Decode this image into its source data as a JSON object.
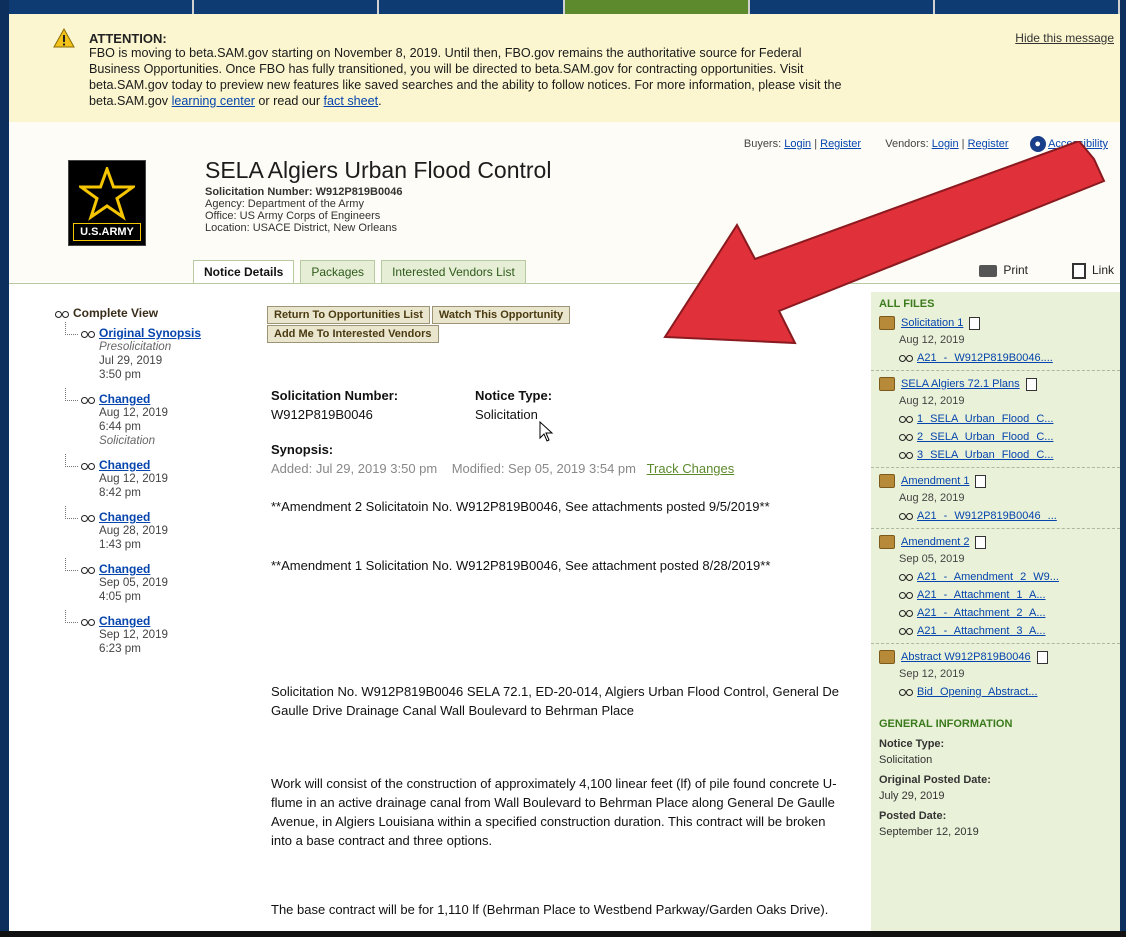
{
  "attention": {
    "title": "ATTENTION:",
    "hide": "Hide this message",
    "line1": "FBO is moving to beta.SAM.gov starting on November 8, 2019. Until then, FBO.gov remains the authoritative source for Federal",
    "line2": "Business Opportunities. Once FBO has fully transitioned, you will be directed to beta.SAM.gov for contracting opportunities. Visit",
    "line3": "beta.SAM.gov today to preview new features like saved searches and the ability to follow notices. For more information, please visit the",
    "line4_prefix": "beta.SAM.gov",
    "learning_center": "learning center",
    "line4_mid": "or read our",
    "fact_sheet": "fact sheet",
    "line4_suffix": "."
  },
  "login": {
    "buyers_label": "Buyers:",
    "buyers_login": "Login",
    "buyers_register": "Register",
    "vendors_label": "Vendors:",
    "vendors_login": "Login",
    "vendors_register": "Register",
    "accessibility": "Accessibility"
  },
  "logo": {
    "text": "U.S.ARMY"
  },
  "notice": {
    "title": "SELA Algiers Urban Flood Control",
    "solicitation_line": "Solicitation Number: W912P819B0046",
    "agency": "Agency: Department of the Army",
    "office": "Office: US Army Corps of Engineers",
    "location": "Location: USACE District, New Orleans"
  },
  "tabs": [
    {
      "label": "Notice Details"
    },
    {
      "label": "Packages"
    },
    {
      "label": "Interested Vendors List"
    }
  ],
  "tools": {
    "print": "Print",
    "link": "Link"
  },
  "history": {
    "title": "Complete View",
    "items": [
      {
        "label": "Original Synopsis",
        "type": "Presolicitation",
        "date": "Jul 29, 2019",
        "time": "3:50 pm"
      },
      {
        "label": "Changed",
        "date": "Aug 12, 2019",
        "time": "6:44 pm",
        "type": "Solicitation"
      },
      {
        "label": "Changed",
        "date": "Aug 12, 2019",
        "time": "8:42 pm"
      },
      {
        "label": "Changed",
        "date": "Aug 28, 2019",
        "time": "1:43 pm"
      },
      {
        "label": "Changed",
        "date": "Sep 05, 2019",
        "time": "4:05 pm"
      },
      {
        "label": "Changed",
        "date": "Sep 12, 2019",
        "time": "6:23 pm"
      }
    ]
  },
  "actions": {
    "return": "Return To Opportunities List",
    "watch": "Watch This Opportunity",
    "add_me": "Add Me To Interested Vendors"
  },
  "details": {
    "sol_number_label": "Solicitation Number:",
    "sol_number": "W912P819B0046",
    "notice_type_label": "Notice Type:",
    "notice_type": "Solicitation",
    "synopsis_label": "Synopsis:",
    "added": "Added: Jul 29, 2019 3:50 pm",
    "modified": "Modified: Sep 05, 2019 3:54 pm",
    "track_changes": "Track Changes",
    "amend2": "**Amendment 2 Solicitatoin No. W912P819B0046, See attachments posted 9/5/2019**",
    "amend1": "**Amendment 1 Solicitation No. W912P819B0046, See attachment posted 8/28/2019**",
    "body1": "Solicitation No. W912P819B0046 SELA 72.1, ED-20-014, Algiers Urban Flood Control, General De Gaulle Drive Drainage Canal Wall Boulevard to Behrman Place",
    "body2": "Work will consist of the construction of approximately 4,100 linear feet (lf) of pile found concrete U-flume in an active drainage canal from Wall Boulevard to Behrman Place along General De Gaulle Avenue, in Algiers Louisiana within a specified construction duration. This contract will be broken into a base contract and three options.",
    "body3": "The base contract will be for 1,110 lf (Behrman Place to Westbend Parkway/Garden Oaks Drive)."
  },
  "files": {
    "title": "ALL FILES",
    "groups": [
      {
        "name": "Solicitation 1",
        "date": "Aug 12, 2019",
        "items": [
          "A21 - W912P819B0046...."
        ]
      },
      {
        "name": "SELA Algiers 72.1 Plans",
        "date": "Aug 12, 2019",
        "items": [
          "1 SELA Urban Flood C...",
          "2 SELA Urban Flood C...",
          "3 SELA Urban Flood C..."
        ]
      },
      {
        "name": "Amendment 1",
        "date": "Aug 28, 2019",
        "items": [
          "A21 - W912P819B0046 ..."
        ]
      },
      {
        "name": "Amendment 2",
        "date": "Sep 05, 2019",
        "items": [
          "A21 - Amendment 2 W9...",
          "A21 - Attachment 1 A...",
          "A21 - Attachment 2 A...",
          "A21 - Attachment 3 A..."
        ]
      },
      {
        "name": "Abstract W912P819B0046",
        "date": "Sep 12, 2019",
        "items": [
          "Bid Opening Abstract..."
        ]
      }
    ]
  },
  "general_info": {
    "title": "GENERAL INFORMATION",
    "notice_type_label": "Notice Type:",
    "notice_type": "Solicitation",
    "orig_posted_label": "Original Posted Date:",
    "orig_posted": "July 29, 2019",
    "posted_label": "Posted Date:",
    "posted": "September 12, 2019"
  },
  "colors": {
    "banner_bg": "#fbf6cf",
    "sidebar_bg": "#e9f1d8",
    "link": "#0645ad",
    "arrow": "#e0303a",
    "frame": "#0c2f5e"
  }
}
